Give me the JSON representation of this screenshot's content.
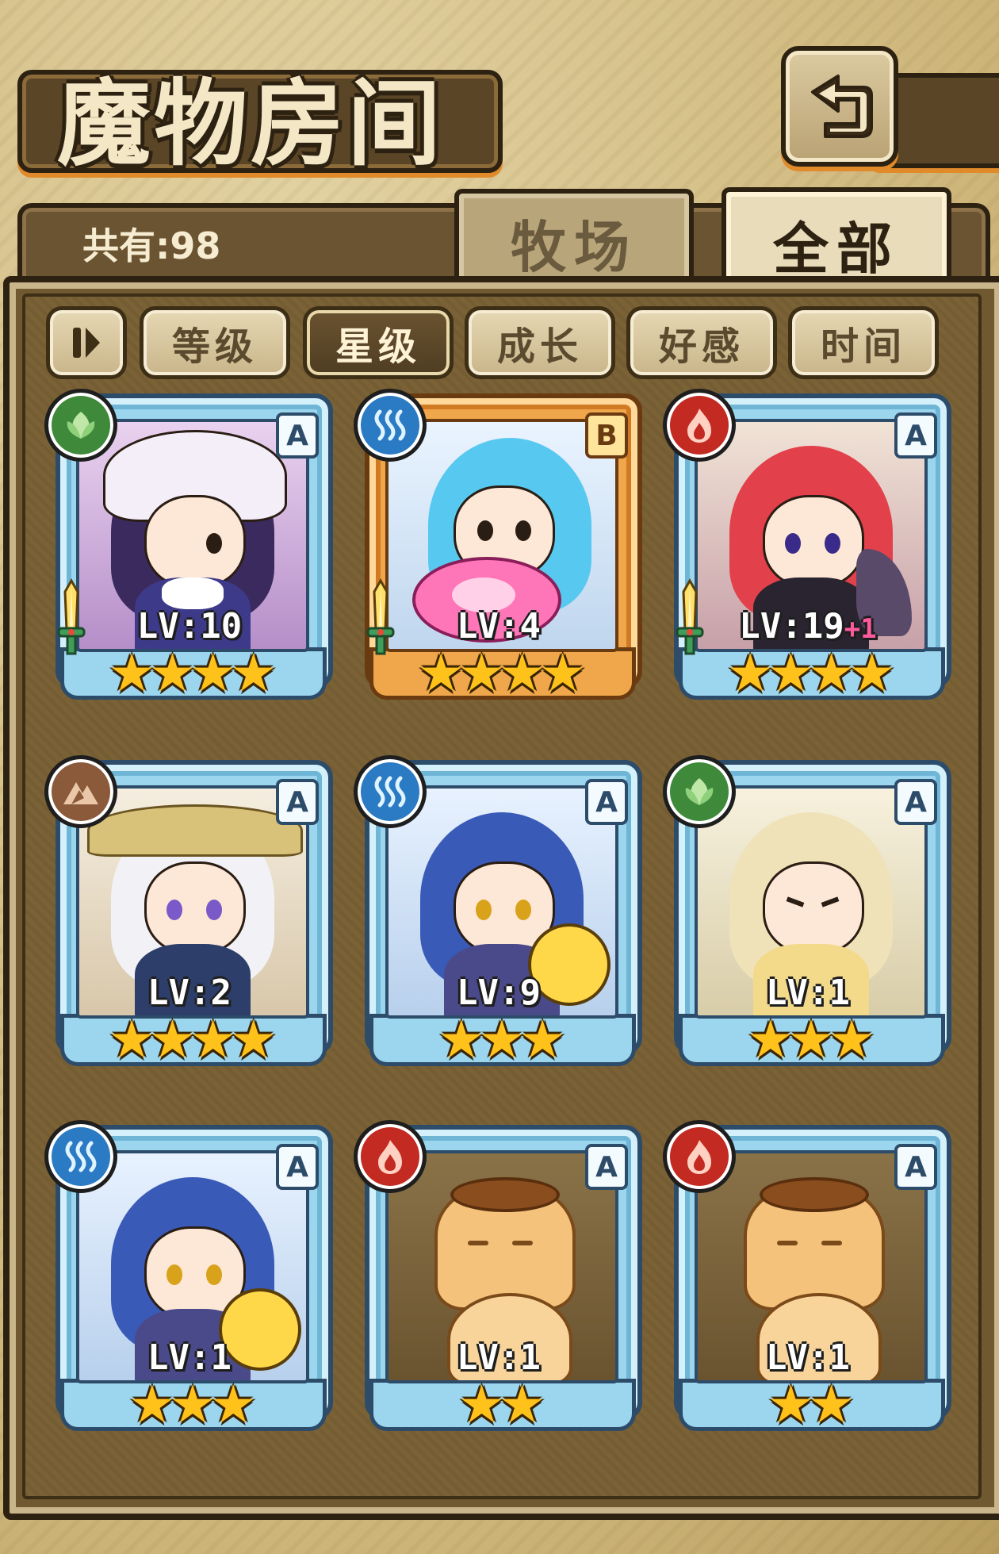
{
  "screen": {
    "title": "魔物房间",
    "back_icon": "return-icon",
    "count_text": "共有:98",
    "tabs": [
      {
        "label": "牧场",
        "active": false
      },
      {
        "label": "全部",
        "active": true
      }
    ],
    "sort_buttons": [
      {
        "label": "等级",
        "active": false
      },
      {
        "label": "星级",
        "active": true
      },
      {
        "label": "成长",
        "active": false
      },
      {
        "label": "好感",
        "active": false
      },
      {
        "label": "时间",
        "active": false
      }
    ]
  },
  "monsters": [
    {
      "element": "grass",
      "rank": "A",
      "lv": "LV:10",
      "plus": "",
      "stars": "★★★★",
      "weapon": true,
      "frame": "blue",
      "art": "witch"
    },
    {
      "element": "water",
      "rank": "B",
      "lv": "LV:4",
      "plus": "",
      "stars": "★★★★",
      "weapon": true,
      "frame": "orange",
      "art": "swimmer"
    },
    {
      "element": "fire",
      "rank": "A",
      "lv": "LV:19",
      "plus": "+1",
      "stars": "★★★★",
      "weapon": true,
      "frame": "blue",
      "art": "demon"
    },
    {
      "element": "earth",
      "rank": "A",
      "lv": "LV:2",
      "plus": "",
      "stars": "★★★★",
      "weapon": false,
      "frame": "blue",
      "art": "farmer"
    },
    {
      "element": "water",
      "rank": "A",
      "lv": "LV:9",
      "plus": "",
      "stars": "★★★",
      "weapon": false,
      "frame": "blue",
      "art": "catgirl"
    },
    {
      "element": "grass",
      "rank": "A",
      "lv": "LV:1",
      "plus": "",
      "stars": "★★★",
      "weapon": false,
      "frame": "blue",
      "art": "fairy"
    },
    {
      "element": "water",
      "rank": "A",
      "lv": "LV:1",
      "plus": "",
      "stars": "★★★",
      "weapon": false,
      "frame": "blue",
      "art": "catgirl"
    },
    {
      "element": "fire",
      "rank": "A",
      "lv": "LV:1",
      "plus": "",
      "stars": "★★",
      "weapon": false,
      "frame": "blue",
      "art": "pudding"
    },
    {
      "element": "fire",
      "rank": "A",
      "lv": "LV:1",
      "plus": "",
      "stars": "★★",
      "weapon": false,
      "frame": "blue",
      "art": "pudding"
    }
  ],
  "colors": {
    "grass": "#3f8a3a",
    "water": "#2b7ac4",
    "fire": "#c22a22",
    "earth": "#8a5a3a",
    "star": "#ffc21a"
  }
}
